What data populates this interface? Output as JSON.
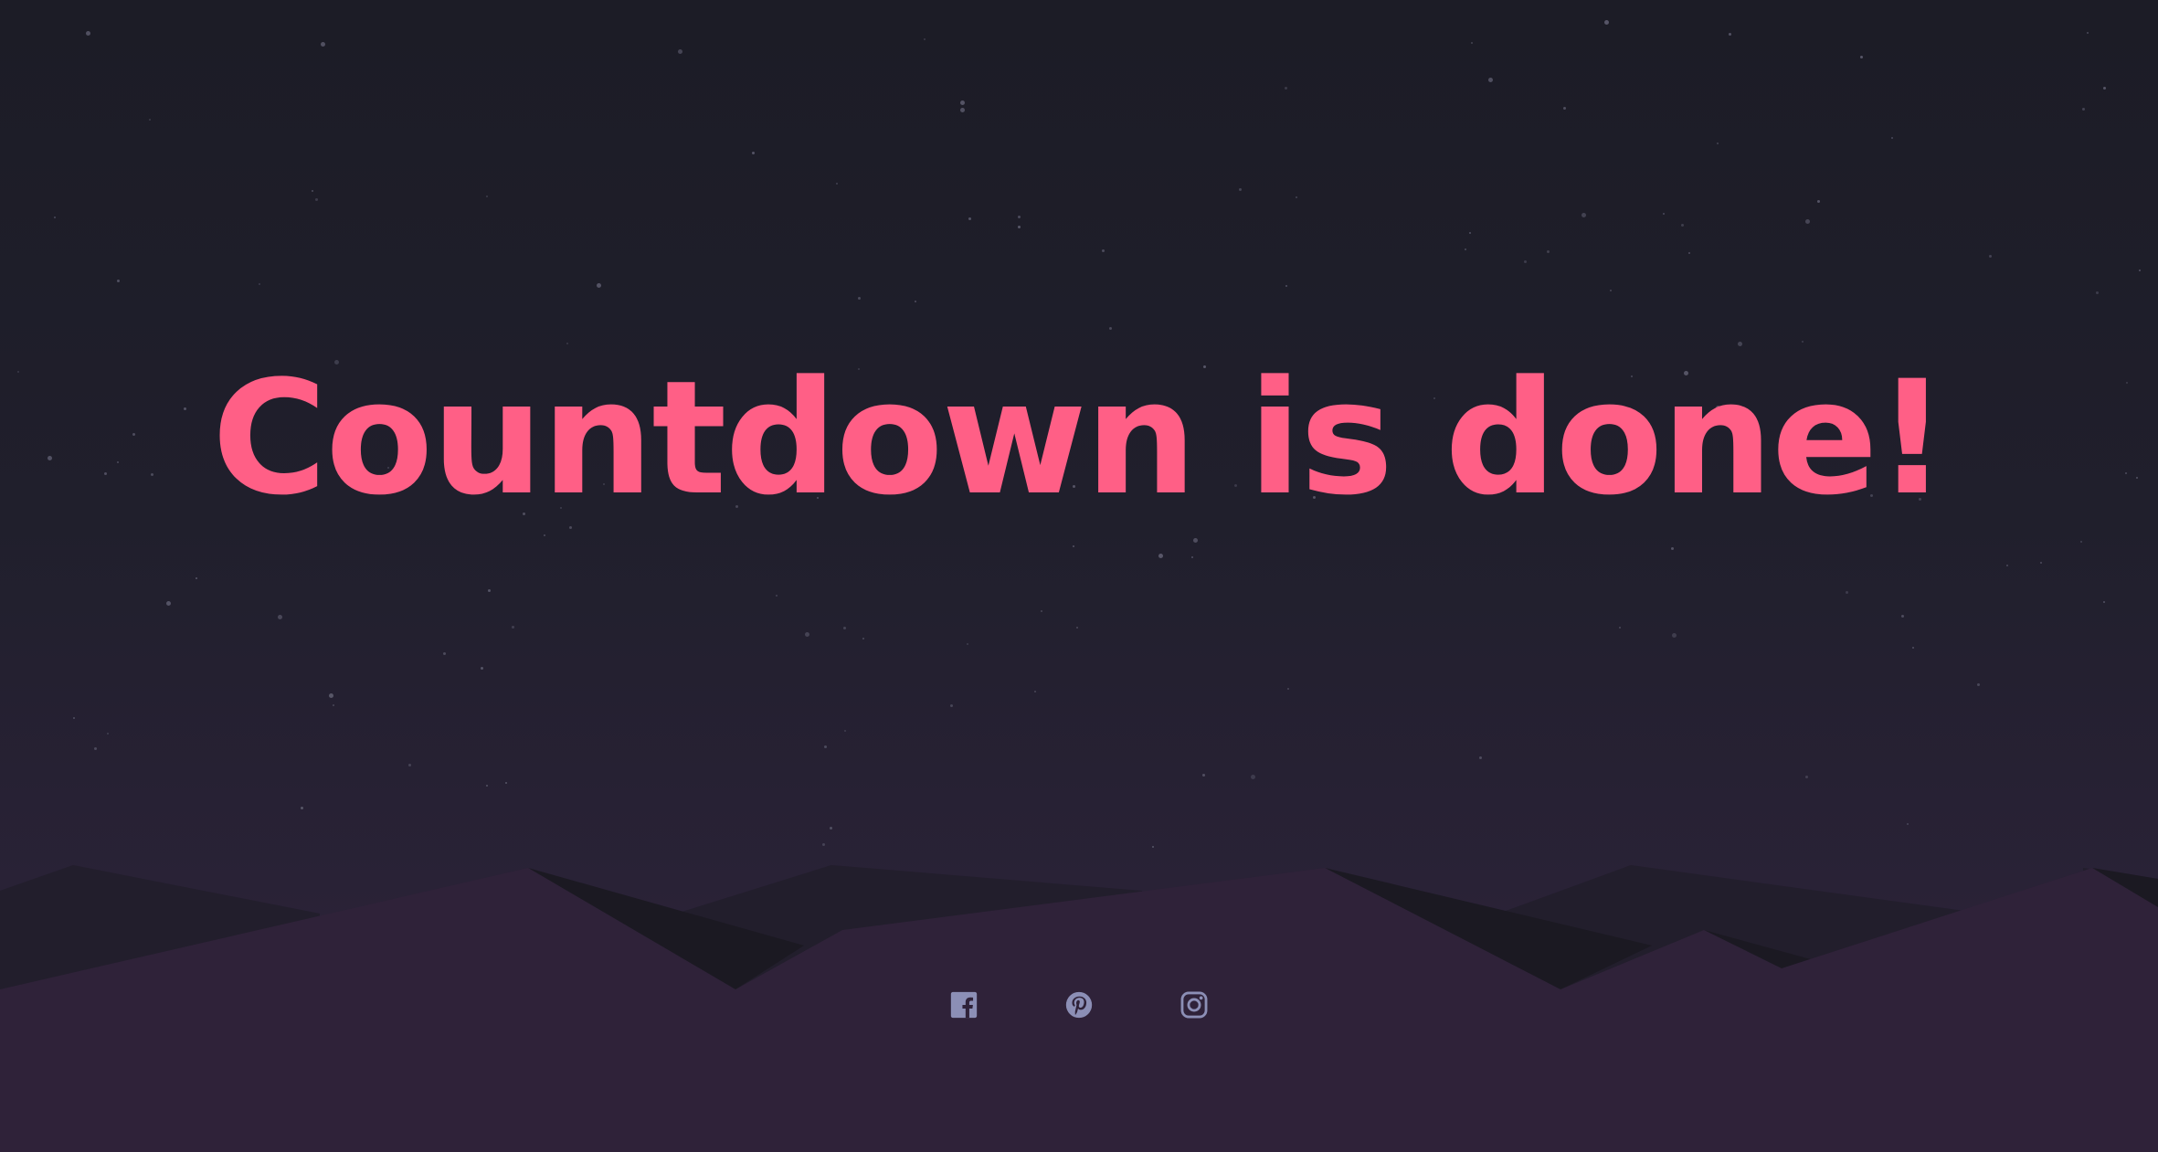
{
  "main": {
    "heading": "Countdown is done!"
  },
  "social": {
    "links": [
      {
        "icon": "facebook-icon"
      },
      {
        "icon": "pinterest-icon"
      },
      {
        "icon": "instagram-icon"
      }
    ]
  },
  "colors": {
    "accent": "#ff5f86",
    "icon": "#8c8fb6",
    "sky": "#1e1d29",
    "ground": "#2f2239"
  }
}
